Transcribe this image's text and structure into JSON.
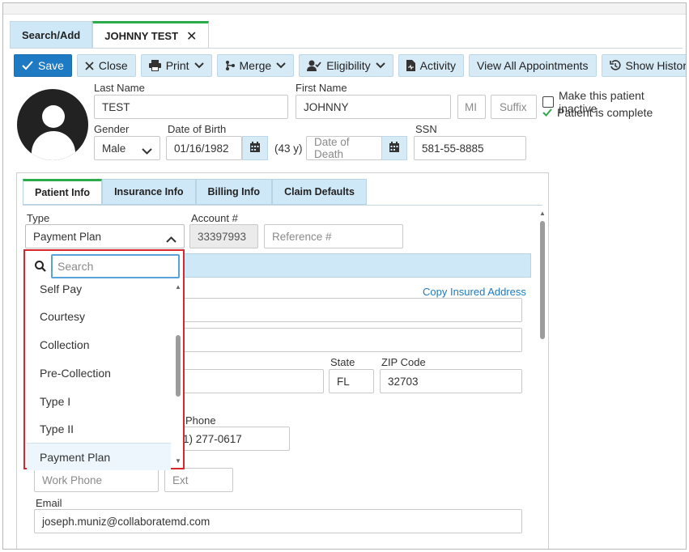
{
  "tabs": {
    "search_add": "Search/Add",
    "patient_tab": "JOHNNY TEST",
    "close_glyph": "✕"
  },
  "toolbar": {
    "save": "Save",
    "close": "Close",
    "print": "Print",
    "merge": "Merge",
    "eligibility": "Eligibility",
    "activity": "Activity",
    "view_all_appointments": "View All Appointments",
    "show_history": "Show History"
  },
  "patient": {
    "last_name_label": "Last Name",
    "last_name": "TEST",
    "first_name_label": "First Name",
    "first_name": "JOHNNY",
    "mi_placeholder": "MI",
    "suffix_placeholder": "Suffix",
    "inactive_label": "Make this patient inactive",
    "complete_label": "Patient is complete",
    "gender_label": "Gender",
    "gender": "Male",
    "dob_label": "Date of Birth",
    "dob": "01/16/1982",
    "age": "(43 y)",
    "dod_placeholder": "Date of Death",
    "ssn_label": "SSN",
    "ssn": "581-55-8885"
  },
  "panel": {
    "tabs": [
      "Patient Info",
      "Insurance Info",
      "Billing Info",
      "Claim Defaults"
    ],
    "type_label": "Type",
    "type_value": "Payment Plan",
    "account_label": "Account #",
    "account_value": "33397993",
    "reference_placeholder": "Reference #",
    "copy_insured_address": "Copy Insured Address",
    "state_label": "State",
    "state_value": "FL",
    "zip_label": "ZIP Code",
    "zip_value": "32703",
    "phone_label": "Phone",
    "phone_value_partial": "1) 277-0617",
    "work_phone_placeholder": "Work Phone",
    "ext_placeholder": "Ext",
    "email_label": "Email",
    "email_value": "joseph.muniz@collaboratemd.com"
  },
  "dropdown": {
    "search_placeholder": "Search",
    "options": [
      "Self Pay",
      "Courtesy",
      "Collection",
      "Pre-Collection",
      "Type I",
      "Type II",
      "Payment Plan"
    ],
    "selected": "Payment Plan"
  },
  "colors": {
    "primary": "#1d7ac3",
    "light_blue": "#d7ebf7",
    "accent_green": "#2cab4a",
    "highlight_red": "#d9262c"
  }
}
